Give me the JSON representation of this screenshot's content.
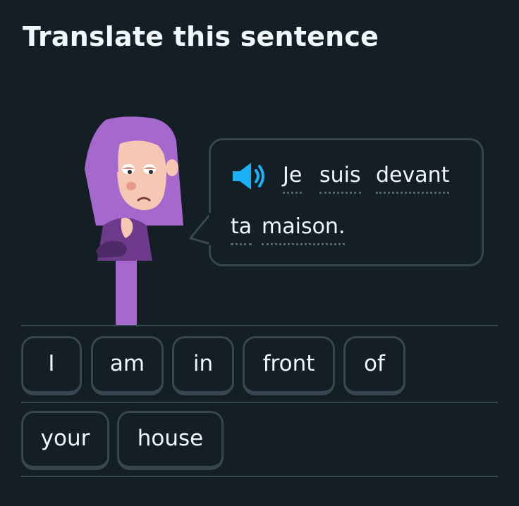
{
  "header": {
    "title": "Translate this sentence"
  },
  "prompt": {
    "speaker_icon": "speaker-icon",
    "words_line1": [
      "Je",
      "suis",
      "devant"
    ],
    "words_line2": [
      "ta",
      "maison."
    ]
  },
  "word_bank": {
    "row1": [
      "I",
      "am",
      "in",
      "front",
      "of"
    ],
    "row2": [
      "your",
      "house"
    ]
  },
  "colors": {
    "background": "#131f24",
    "border": "#37464f",
    "text": "#f1f7fb",
    "speaker_blue": "#1cb0f6",
    "character_purple": "#a568cc"
  }
}
